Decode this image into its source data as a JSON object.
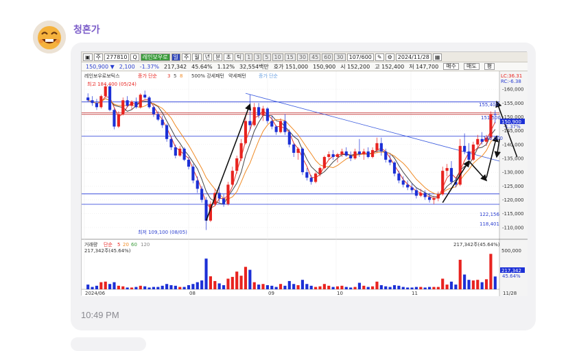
{
  "message": {
    "sender_name": "청혼가",
    "time": "10:49 PM"
  },
  "toolbar": {
    "period": "주",
    "code": "277810",
    "name": "레인보우로",
    "interval_buttons": [
      "일",
      "주",
      "월",
      "년",
      "분",
      "초",
      "틱"
    ],
    "number_buttons": [
      "1",
      "3",
      "5",
      "10",
      "15",
      "30",
      "45",
      "60",
      "30"
    ],
    "count": "107",
    "count_total": "600",
    "date": "2024/11/28"
  },
  "quote_bar": {
    "price": "150,900",
    "change": "2,100",
    "change_pct": "-1.37%",
    "volume": "217,342",
    "vol_pct": "45.64%",
    "turnover": "1.12%",
    "amount": "32,554백만",
    "ask": "호가 151,000",
    "bid": "150,900",
    "open": "시 152,200",
    "high": "고 152,400",
    "low": "저 147,700",
    "buy_button": "매수",
    "sell_button": "매도",
    "avg_button": "평"
  },
  "chart_header": {
    "stock_name": "레인보우로보틱스",
    "ma_label": "종가 단순",
    "ma_periods": [
      "3",
      "5",
      "8"
    ],
    "pattern1": "500% 강세패턴",
    "pattern2": "약세패턴",
    "extra": "종가 단순",
    "lc": "LC:36.31",
    "rc": "RC:-6.38"
  },
  "annotations": {
    "high": "최고 184,400 (05/24)",
    "low": "최저 109,100 (08/05)"
  },
  "price_lines": {
    "l155": "155,400",
    "l151": "151,500",
    "l143": "143,000",
    "l122": "122,156",
    "l118": "118,401"
  },
  "current_price_tag": "150,900",
  "current_change_tag": "-1.37%",
  "volume_panel": {
    "title": "거래량",
    "ma_label": "단순",
    "ma_periods": [
      "5",
      "20",
      "60",
      "120"
    ],
    "left_value": "217,342주(45.64%)",
    "right_value": "217,342주(45.64%)",
    "axis_tick": "500,000",
    "tag_value": "217,342",
    "tag_pct": "45.64%"
  },
  "chart_data": {
    "type": "candlestick",
    "y_axis_ticks": [
      "160,000",
      "155,000",
      "150,000",
      "145,000",
      "140,000",
      "135,000",
      "130,000",
      "125,000",
      "120,000",
      "115,000",
      "110,000"
    ],
    "x_axis_ticks": [
      "2024/06",
      "08",
      "09",
      "10",
      "11",
      "11/28"
    ],
    "ylim": [
      107000,
      163000
    ],
    "prices": [
      [
        157000,
        158500,
        155500,
        156000
      ],
      [
        156000,
        157500,
        154000,
        155000
      ],
      [
        155000,
        156500,
        152500,
        153500
      ],
      [
        153500,
        158000,
        153000,
        157500
      ],
      [
        157500,
        162000,
        157000,
        161000
      ],
      [
        161000,
        161500,
        152000,
        152500
      ],
      [
        152500,
        153000,
        145500,
        146500
      ],
      [
        146500,
        152000,
        146000,
        151000
      ],
      [
        151000,
        157000,
        150500,
        156000
      ],
      [
        156000,
        157500,
        153500,
        154000
      ],
      [
        154000,
        156000,
        152500,
        155500
      ],
      [
        155500,
        157000,
        153000,
        153500
      ],
      [
        153500,
        158500,
        153000,
        158000
      ],
      [
        158000,
        159500,
        156500,
        157000
      ],
      [
        157000,
        157500,
        153000,
        153500
      ],
      [
        153500,
        154000,
        150000,
        151000
      ],
      [
        151000,
        152000,
        148500,
        149000
      ],
      [
        149000,
        150500,
        146000,
        147000
      ],
      [
        147000,
        147500,
        141000,
        142000
      ],
      [
        142000,
        143000,
        138000,
        139000
      ],
      [
        139000,
        140000,
        135000,
        136000
      ],
      [
        136000,
        139500,
        135500,
        138500
      ],
      [
        138500,
        139000,
        134000,
        134500
      ],
      [
        134500,
        135500,
        131000,
        132000
      ],
      [
        132000,
        133000,
        126000,
        127000
      ],
      [
        127000,
        128500,
        122500,
        124000
      ],
      [
        124000,
        125000,
        119000,
        120000
      ],
      [
        120000,
        121000,
        109100,
        112500
      ],
      [
        112500,
        119500,
        112000,
        118500
      ],
      [
        118500,
        124000,
        118000,
        122500
      ],
      [
        122500,
        125000,
        119000,
        120500
      ],
      [
        120500,
        122000,
        117500,
        118500
      ],
      [
        118500,
        126500,
        118000,
        125500
      ],
      [
        125500,
        132000,
        125000,
        130500
      ],
      [
        130500,
        136000,
        129500,
        135000
      ],
      [
        135000,
        142000,
        134000,
        140500
      ],
      [
        140500,
        150000,
        140000,
        148500
      ],
      [
        148500,
        158000,
        145000,
        147000
      ],
      [
        147000,
        155000,
        146500,
        153500
      ],
      [
        153500,
        155000,
        149500,
        150500
      ],
      [
        150500,
        154000,
        148500,
        153000
      ],
      [
        153000,
        153500,
        147500,
        148500
      ],
      [
        148500,
        150500,
        145500,
        146500
      ],
      [
        146500,
        147000,
        143500,
        144500
      ],
      [
        144500,
        149500,
        144000,
        148500
      ],
      [
        148500,
        151000,
        143500,
        144500
      ],
      [
        144500,
        145500,
        139000,
        140000
      ],
      [
        140000,
        140500,
        135500,
        137000
      ],
      [
        137000,
        139000,
        134500,
        138500
      ],
      [
        138500,
        139000,
        129000,
        130000
      ],
      [
        130000,
        131500,
        127000,
        128000
      ],
      [
        128000,
        129000,
        125500,
        126500
      ],
      [
        126500,
        130000,
        126000,
        129500
      ],
      [
        129500,
        132000,
        128500,
        131500
      ],
      [
        131500,
        136000,
        131000,
        135500
      ],
      [
        135500,
        137500,
        134500,
        136500
      ],
      [
        136500,
        138000,
        134500,
        135500
      ],
      [
        135500,
        137000,
        133500,
        136500
      ],
      [
        136500,
        138500,
        135500,
        137500
      ],
      [
        137500,
        139000,
        135500,
        136000
      ],
      [
        136000,
        137500,
        134000,
        135000
      ],
      [
        135000,
        138500,
        134500,
        137500
      ],
      [
        137500,
        142000,
        135500,
        136500
      ],
      [
        136500,
        138500,
        134500,
        137500
      ],
      [
        137500,
        139000,
        135000,
        135500
      ],
      [
        135500,
        139000,
        135000,
        138000
      ],
      [
        138000,
        142500,
        137000,
        140500
      ],
      [
        140500,
        142500,
        136000,
        137500
      ],
      [
        137500,
        138500,
        133500,
        134500
      ],
      [
        134500,
        136500,
        132500,
        133500
      ],
      [
        133500,
        134000,
        128500,
        129500
      ],
      [
        129500,
        130500,
        126000,
        127000
      ],
      [
        127000,
        128500,
        124500,
        125500
      ],
      [
        125500,
        127000,
        123500,
        124500
      ],
      [
        124500,
        126000,
        122500,
        123500
      ],
      [
        123500,
        124500,
        120500,
        121500
      ],
      [
        121500,
        124000,
        121000,
        122500
      ],
      [
        122500,
        123500,
        120000,
        121000
      ],
      [
        121000,
        122500,
        119000,
        120000
      ],
      [
        120000,
        121500,
        118500,
        120500
      ],
      [
        120500,
        123000,
        119500,
        122000
      ],
      [
        122000,
        132000,
        121500,
        130500
      ],
      [
        130500,
        133000,
        128500,
        131500
      ],
      [
        131500,
        134000,
        125500,
        126500
      ],
      [
        126500,
        128000,
        124500,
        125500
      ],
      [
        125500,
        142000,
        125000,
        139500
      ],
      [
        139500,
        144000,
        136500,
        137500
      ],
      [
        137500,
        140500,
        133500,
        134500
      ],
      [
        134500,
        141000,
        134000,
        140000
      ],
      [
        140000,
        143500,
        138500,
        142000
      ],
      [
        142000,
        144500,
        140000,
        141000
      ],
      [
        141000,
        143500,
        139500,
        142500
      ],
      [
        142500,
        152000,
        141500,
        151000
      ],
      [
        151000,
        152400,
        147700,
        150900
      ]
    ],
    "volume": [
      80,
      40,
      60,
      120,
      130,
      90,
      120,
      60,
      50,
      30,
      30,
      40,
      60,
      50,
      30,
      40,
      40,
      60,
      90,
      70,
      60,
      40,
      40,
      70,
      90,
      120,
      150,
      520,
      220,
      140,
      100,
      70,
      180,
      210,
      300,
      230,
      380,
      330,
      120,
      80,
      90,
      70,
      60,
      40,
      90,
      60,
      140,
      90,
      70,
      160,
      90,
      60,
      40,
      50,
      90,
      60,
      40,
      50,
      60,
      40,
      30,
      40,
      110,
      60,
      40,
      50,
      130,
      70,
      50,
      40,
      70,
      60,
      40,
      30,
      30,
      40,
      40,
      30,
      40,
      40,
      40,
      180,
      80,
      130,
      80,
      500,
      250,
      160,
      150,
      160,
      120,
      170,
      600,
      217
    ],
    "volume_ylim": [
      0,
      650
    ]
  },
  "colors": {
    "up": "#e8231f",
    "down": "#1c30d6",
    "ma3": "#e23a2c",
    "ma5": "#444444",
    "ma8": "#f08a24"
  }
}
